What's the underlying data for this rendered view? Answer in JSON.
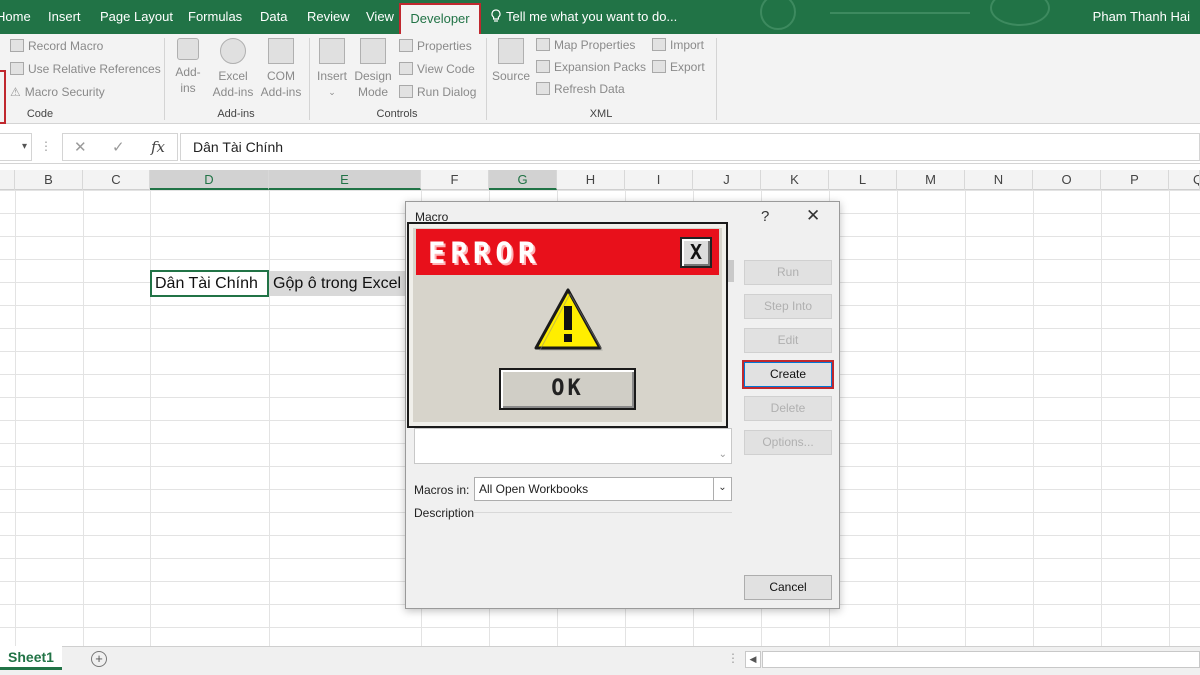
{
  "ribbon": {
    "tabs": [
      {
        "label": "Home"
      },
      {
        "label": "Insert"
      },
      {
        "label": "Page Layout"
      },
      {
        "label": "Formulas"
      },
      {
        "label": "Data"
      },
      {
        "label": "Review"
      },
      {
        "label": "View"
      },
      {
        "label": "Developer",
        "active": true
      }
    ],
    "tell_me": "Tell me what you want to do...",
    "user": "Pham Thanh Hai",
    "code": {
      "record_macro": "Record Macro",
      "relative_refs": "Use Relative References",
      "macro_security": "Macro Security",
      "label": "Code"
    },
    "addins": {
      "addins_top": "Add-",
      "addins_bottom": "ins",
      "excel_top": "Excel",
      "excel_bottom": "Add-ins",
      "com_top": "COM",
      "com_bottom": "Add-ins",
      "label": "Add-ins"
    },
    "controls": {
      "insert": "Insert",
      "design_top": "Design",
      "design_bottom": "Mode",
      "properties": "Properties",
      "view_code": "View Code",
      "run_dialog": "Run Dialog",
      "label": "Controls"
    },
    "xml": {
      "source": "Source",
      "map_properties": "Map Properties",
      "expansion_packs": "Expansion Packs",
      "refresh_data": "Refresh Data",
      "import": "Import",
      "export": "Export",
      "label": "XML"
    }
  },
  "formula_bar": {
    "fx": "fx",
    "value": "Dân Tài Chính"
  },
  "columns": [
    "B",
    "C",
    "D",
    "E",
    "F",
    "G",
    "H",
    "I",
    "J",
    "K",
    "L",
    "M",
    "N",
    "O",
    "P",
    "Q"
  ],
  "cells": {
    "d": "Dân Tài Chính",
    "e": "Gộp ô trong Excel"
  },
  "sheet": {
    "tab": "Sheet1",
    "add": "+"
  },
  "macro_dialog": {
    "title": "Macro",
    "help": "?",
    "close": "✕",
    "buttons": {
      "run": "Run",
      "step_into": "Step Into",
      "edit": "Edit",
      "create": "Create",
      "delete": "Delete",
      "options": "Options...",
      "cancel": "Cancel"
    },
    "macros_in_label": "Macros in:",
    "macros_in_value": "All Open Workbooks",
    "description_label": "Description"
  },
  "error_box": {
    "title": "ERROR",
    "close": "X",
    "ok": "OK"
  },
  "colors": {
    "excel_green": "#217346",
    "highlight_red": "#c0282e",
    "error_red": "#e8101b",
    "warning_yellow": "#ffee00"
  }
}
